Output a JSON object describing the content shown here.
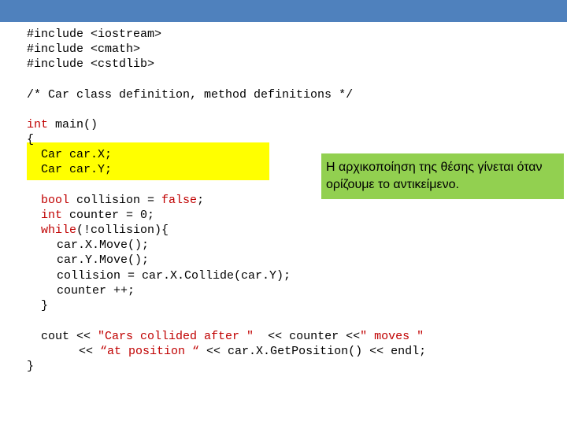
{
  "colors": {
    "top_bar": "#4f81bd",
    "highlight": "#ffff00",
    "callout": "#92d050",
    "keyword": "#c00000"
  },
  "code": {
    "line1": "#include <iostream>",
    "line2": "#include <cmath>",
    "line3": "#include <cstdlib>",
    "line4": "/* Car class definition, method definitions */",
    "line5_kw": "int",
    "line5_rest": " main()",
    "line6": "{",
    "line7": "  Car car.X;",
    "line8": "  Car car.Y;",
    "line9_kw": "bool",
    "line9_mid": " collision = ",
    "line9_kw2": "false",
    "line9_end": ";",
    "line10_kw": "int",
    "line10_rest": " counter = 0;",
    "line11_kw": "while",
    "line11_rest": "(!collision){",
    "line12": "car.X.Move();",
    "line13": "car.Y.Move();",
    "line14": "collision = car.X.Collide(car.Y);",
    "line15": "counter ++;",
    "line16": "}",
    "line17_a": "cout << ",
    "line17_b": "\"Cars collided after \"",
    "line17_c": "  << counter <<",
    "line17_d": "\" moves \"",
    "line18_a": "<< ",
    "line18_b": "“at position “",
    "line18_c": " << car.X.GetPosition() << endl;",
    "line19": "}"
  },
  "callout": {
    "text": "Η αρχικοποίηση της θέσης γίνεται όταν ορίζουμε το αντικείμενο."
  }
}
